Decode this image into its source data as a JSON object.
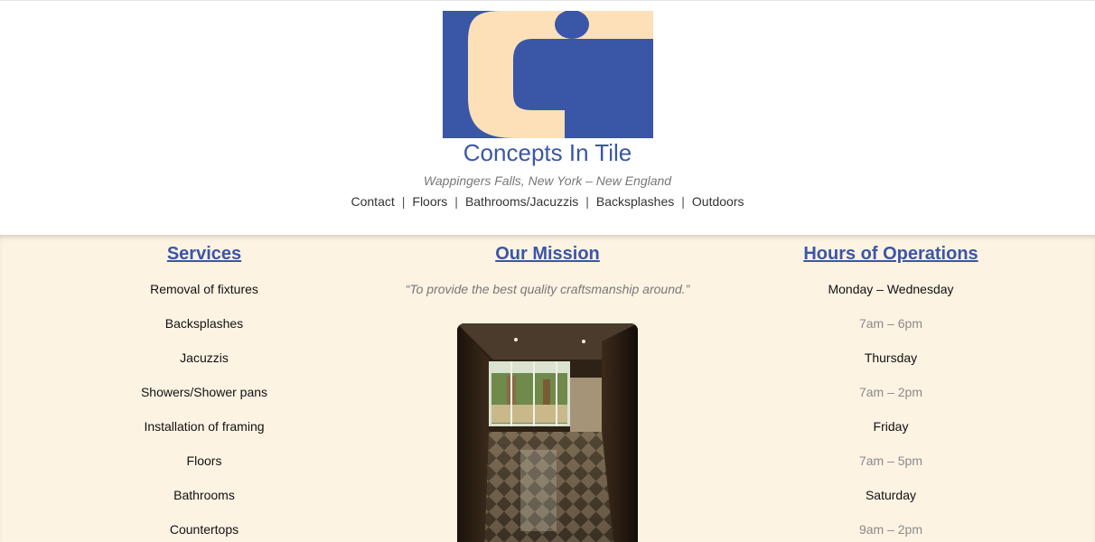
{
  "brand": {
    "title": "Concepts In Tile",
    "tagline": "Wappingers Falls, New York – New England",
    "logo_colors": {
      "blue": "#3a56a7",
      "cream": "#fde0b8"
    }
  },
  "nav": {
    "items": [
      {
        "label": "Contact"
      },
      {
        "label": "Floors"
      },
      {
        "label": "Bathrooms/Jacuzzis"
      },
      {
        "label": "Backsplashes"
      },
      {
        "label": "Outdoors"
      }
    ],
    "separator": "|"
  },
  "services": {
    "heading": "Services",
    "items": [
      "Removal of fixtures",
      "Backsplashes",
      "Jacuzzis",
      "Showers/Shower pans",
      "Installation of framing",
      "Floors",
      "Bathrooms",
      "Countertops"
    ]
  },
  "mission": {
    "heading": "Our Mission",
    "quote": "“To provide the best quality craftsmanship around.”"
  },
  "hours": {
    "heading": "Hours of Operations",
    "rows": [
      {
        "day": "Monday – Wednesday",
        "time": "7am – 6pm"
      },
      {
        "day": "Thursday",
        "time": "7am – 2pm"
      },
      {
        "day": "Friday",
        "time": "7am – 5pm"
      },
      {
        "day": "Saturday",
        "time": "9am – 2pm"
      }
    ]
  },
  "colors": {
    "accent": "#3a56a7",
    "band_background": "#fdf3e3",
    "muted_text": "#8a8a8a"
  }
}
